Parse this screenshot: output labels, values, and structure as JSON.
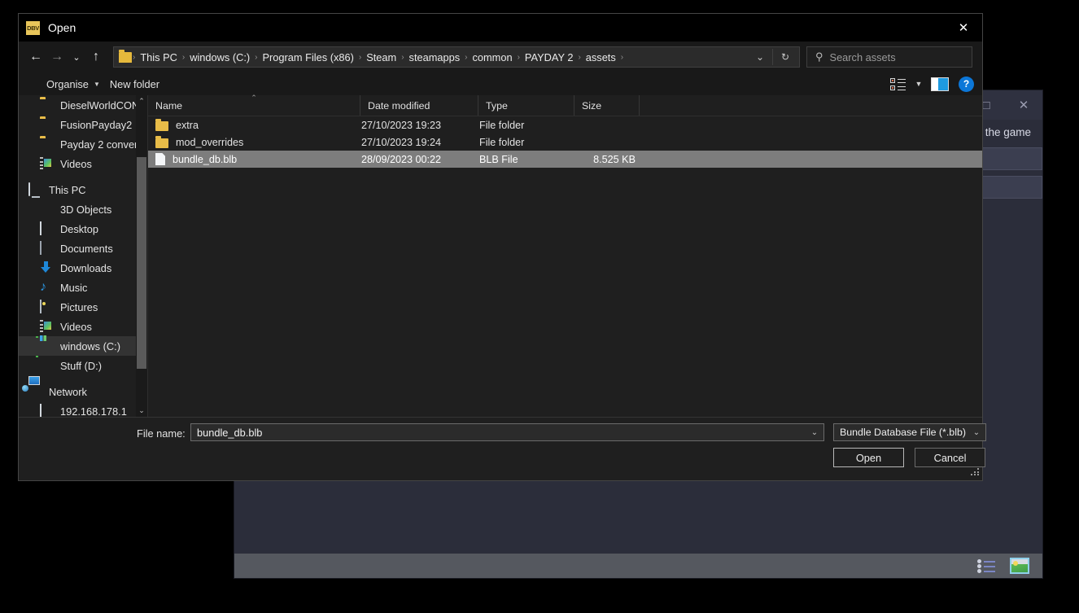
{
  "background_window": {
    "subtitle_text": "ry of the game",
    "maximize_glyph": "□",
    "close_glyph": "✕",
    "statusbar": {
      "list_view_icon": "list-view-icon",
      "thumbnail_view_icon": "thumbnail-view-icon"
    }
  },
  "dialog": {
    "title": "Open",
    "app_icon_text": "DBV",
    "close_glyph": "✕",
    "nav": {
      "back_glyph": "←",
      "forward_glyph": "→",
      "recent_glyph": "⌄",
      "up_glyph": "↑",
      "dropdown_glyph": "⌄",
      "refresh_glyph": "↻"
    },
    "breadcrumbs": [
      "This PC",
      "windows (C:)",
      "Program Files (x86)",
      "Steam",
      "steamapps",
      "common",
      "PAYDAY 2",
      "assets"
    ],
    "breadcrumb_separator": "›",
    "search": {
      "placeholder": "Search assets",
      "icon": "search-icon"
    },
    "toolbar": {
      "organise_label": "Organise",
      "organise_caret": "▼",
      "new_folder_label": "New folder",
      "view_options_icon": "view-options-icon",
      "view_caret": "▼",
      "preview_pane_icon": "preview-pane-icon",
      "help_label": "?"
    },
    "sidebar": {
      "items": [
        {
          "label": "DieselWorldCON",
          "icon": "folder-icon",
          "selected": false,
          "indent": 26
        },
        {
          "label": "FusionPayday2",
          "icon": "folder-icon",
          "selected": false,
          "indent": 26
        },
        {
          "label": "Payday 2 conver",
          "icon": "folder-icon",
          "selected": false,
          "indent": 26
        },
        {
          "label": "Videos",
          "icon": "video-library-icon",
          "selected": false,
          "indent": 26
        },
        {
          "label": "This PC",
          "icon": "this-pc-icon",
          "selected": false,
          "indent": 12
        },
        {
          "label": "3D Objects",
          "icon": "3d-objects-icon",
          "selected": false,
          "indent": 26
        },
        {
          "label": "Desktop",
          "icon": "desktop-icon",
          "selected": false,
          "indent": 26
        },
        {
          "label": "Documents",
          "icon": "documents-icon",
          "selected": false,
          "indent": 26
        },
        {
          "label": "Downloads",
          "icon": "downloads-icon",
          "selected": false,
          "indent": 26
        },
        {
          "label": "Music",
          "icon": "music-icon",
          "selected": false,
          "indent": 26
        },
        {
          "label": "Pictures",
          "icon": "pictures-icon",
          "selected": false,
          "indent": 26
        },
        {
          "label": "Videos",
          "icon": "video-library-icon",
          "selected": false,
          "indent": 26
        },
        {
          "label": "windows (C:)",
          "icon": "windows-drive-icon",
          "selected": true,
          "indent": 26
        },
        {
          "label": "Stuff (D:)",
          "icon": "drive-icon",
          "selected": false,
          "indent": 26
        },
        {
          "label": "Network",
          "icon": "network-icon",
          "selected": false,
          "indent": 12
        },
        {
          "label": "192.168.178.1",
          "icon": "network-computer-icon",
          "selected": false,
          "indent": 26
        }
      ],
      "scroll_up_glyph": "⌃",
      "scroll_down_glyph": "⌄"
    },
    "filelist": {
      "columns": [
        "Name",
        "Date modified",
        "Type",
        "Size"
      ],
      "sort_column": "Name",
      "sort_caret": "⌃",
      "rows": [
        {
          "name": "extra",
          "date_modified": "27/10/2023 19:23",
          "type": "File folder",
          "size": "",
          "icon": "folder-icon",
          "selected": false
        },
        {
          "name": "mod_overrides",
          "date_modified": "27/10/2023 19:24",
          "type": "File folder",
          "size": "",
          "icon": "folder-icon",
          "selected": false
        },
        {
          "name": "bundle_db.blb",
          "date_modified": "28/09/2023 00:22",
          "type": "BLB File",
          "size": "8.525 KB",
          "icon": "file-icon",
          "selected": true
        }
      ]
    },
    "footer": {
      "filename_label": "File name:",
      "filename_value": "bundle_db.blb",
      "filename_caret": "⌄",
      "filetype_value": "Bundle Database File (*.blb)",
      "filetype_caret": "⌄",
      "open_label": "Open",
      "cancel_label": "Cancel"
    }
  },
  "colors": {
    "dialog_bg": "#1f1f1f",
    "titlebar_bg": "#000000",
    "selection_row": "#7d7d7d",
    "sidebar_selection": "#333333",
    "folder_yellow": "#e8bc48",
    "accent_blue": "#0c77d8",
    "bg_window_body": "#2b2d3a",
    "bg_window_status": "#55585f"
  }
}
